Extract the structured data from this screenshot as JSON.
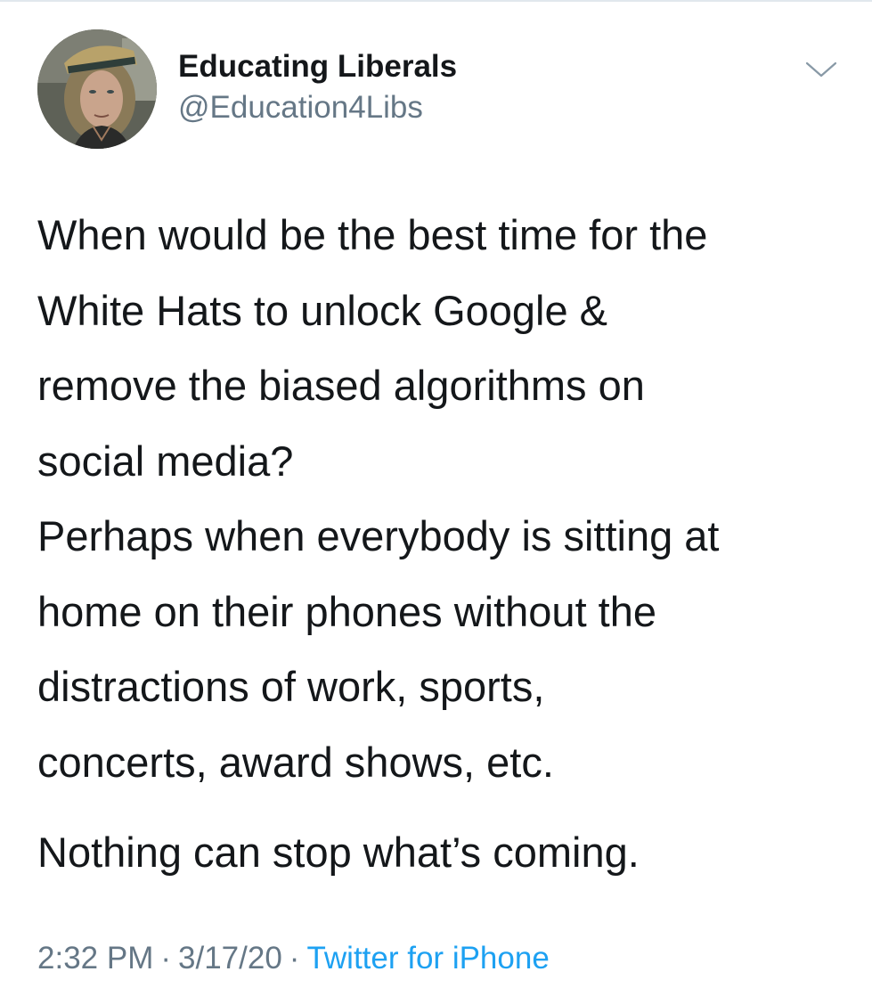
{
  "tweet": {
    "author": {
      "display_name": "Educating Liberals",
      "handle": "@Education4Libs",
      "avatar_icon": "profile-photo-avatar"
    },
    "menu_icon": "chevron-down-icon",
    "paragraphs": [
      [
        "When would be the best time for the",
        "White Hats to unlock Google &",
        "remove the biased algorithms on",
        "social media?"
      ],
      [
        "Perhaps when everybody is sitting at",
        "home on their phones without the",
        "distractions of work, sports,",
        "concerts, award shows, etc."
      ],
      [
        "Nothing can stop what’s coming."
      ]
    ],
    "meta": {
      "time": "2:32 PM",
      "date": "3/17/20",
      "separator": "·",
      "source": "Twitter for iPhone"
    }
  },
  "colors": {
    "text": "#14171a",
    "secondary": "#657786",
    "link": "#1da1f2",
    "divider": "#e1e8ed"
  }
}
